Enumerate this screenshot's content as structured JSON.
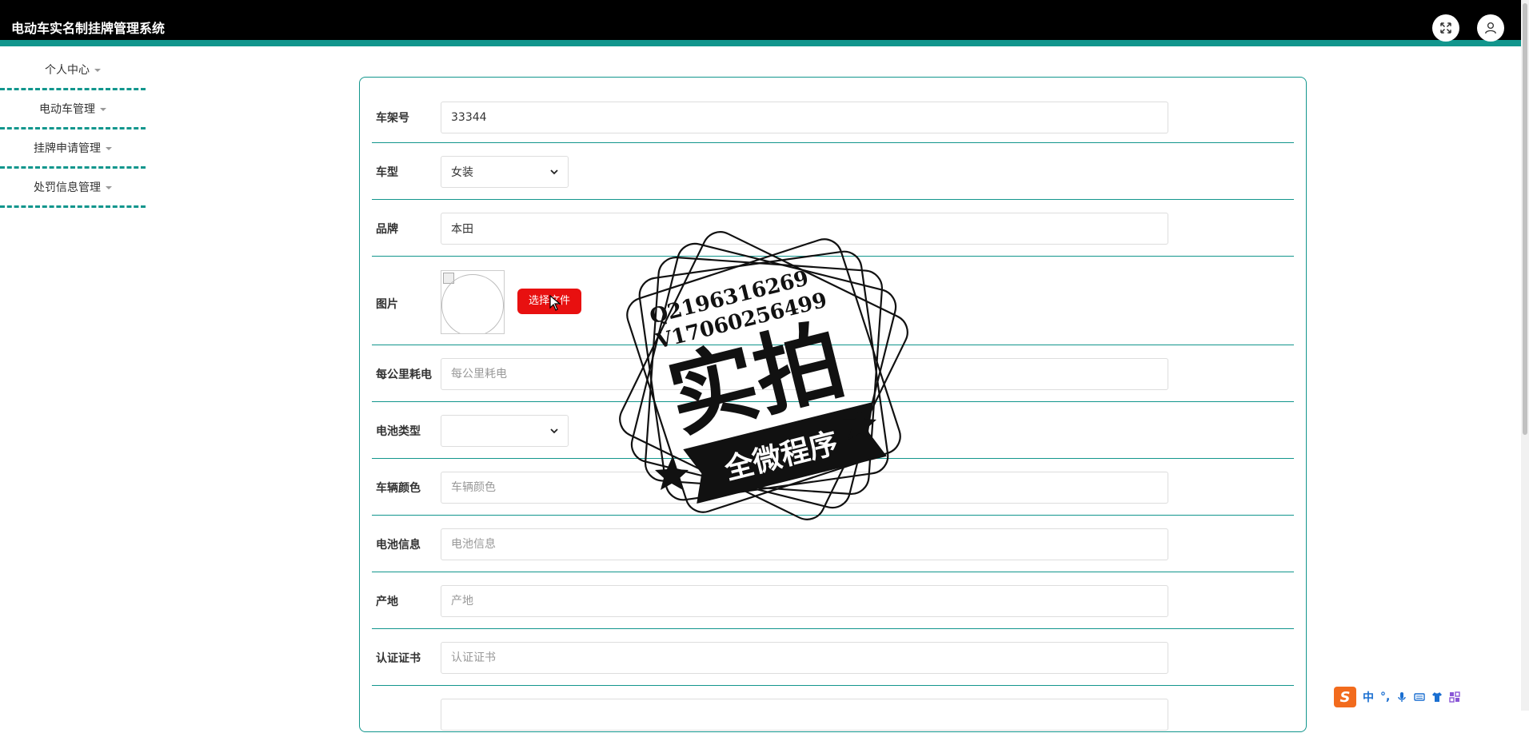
{
  "app": {
    "title": "电动车实名制挂牌管理系统"
  },
  "header": {
    "fullscreen_icon": "expand-arrows-icon",
    "user_icon": "user-icon"
  },
  "sidebar": {
    "items": [
      {
        "label": "个人中心"
      },
      {
        "label": "电动车管理"
      },
      {
        "label": "挂牌申请管理"
      },
      {
        "label": "处罚信息管理"
      }
    ]
  },
  "form": {
    "frame_no": {
      "label": "车架号",
      "value": "33344",
      "placeholder": "车架号"
    },
    "model": {
      "label": "车型",
      "selected": "女装"
    },
    "brand": {
      "label": "品牌",
      "value": "本田",
      "placeholder": "品牌"
    },
    "image": {
      "label": "图片",
      "button": "选择文件"
    },
    "consumption": {
      "label": "每公里耗电",
      "value": "",
      "placeholder": "每公里耗电"
    },
    "battery_type": {
      "label": "电池类型",
      "selected": ""
    },
    "color": {
      "label": "车辆颜色",
      "value": "",
      "placeholder": "车辆颜色"
    },
    "battery_info": {
      "label": "电池信息",
      "value": "",
      "placeholder": "电池信息"
    },
    "origin": {
      "label": "产地",
      "value": "",
      "placeholder": "产地"
    },
    "certificate": {
      "label": "认证证书",
      "value": "",
      "placeholder": "认证证书"
    }
  },
  "watermark": {
    "line1": "Q2196316269",
    "line2": "V17060256499",
    "main": "实拍",
    "banner": "全微程序"
  },
  "ime": {
    "logo": "S",
    "mode": "中",
    "punct": "°,"
  },
  "colors": {
    "accent": "#12968d",
    "header_bg": "#000000",
    "file_button": "#e81010"
  }
}
